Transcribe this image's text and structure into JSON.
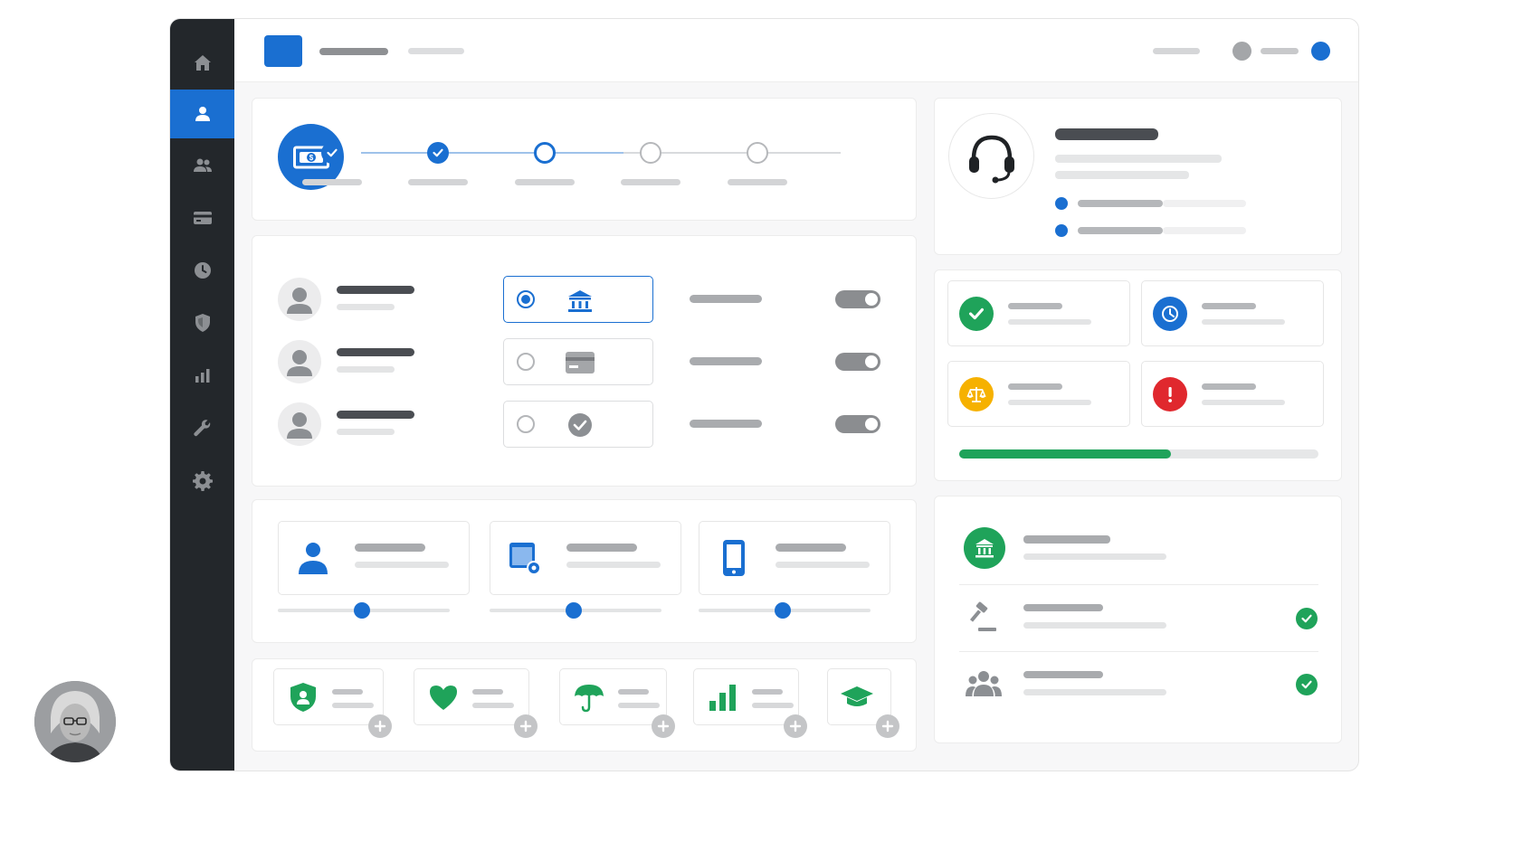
{
  "sidebar": {
    "items": [
      {
        "icon": "home-icon",
        "active": false
      },
      {
        "icon": "user-icon",
        "active": true
      },
      {
        "icon": "users-icon",
        "active": false
      },
      {
        "icon": "card-icon",
        "active": false
      },
      {
        "icon": "clock-icon",
        "active": false
      },
      {
        "icon": "shield-icon",
        "active": false
      },
      {
        "icon": "bar-chart-icon",
        "active": false
      },
      {
        "icon": "wrench-icon",
        "active": false
      },
      {
        "icon": "gear-icon",
        "active": false
      }
    ]
  },
  "stepper": {
    "steps": [
      {
        "state": "done"
      },
      {
        "state": "done"
      },
      {
        "state": "current"
      },
      {
        "state": "pending"
      },
      {
        "state": "pending"
      }
    ]
  },
  "payment_methods": [
    {
      "icon": "bank-icon",
      "selected": true
    },
    {
      "icon": "card-icon",
      "selected": false
    },
    {
      "icon": "check-circle-icon",
      "selected": false
    }
  ],
  "status_tiles": [
    {
      "icon": "check-icon",
      "color": "#1fa35a"
    },
    {
      "icon": "clock-icon",
      "color": "#1a6fd1"
    },
    {
      "icon": "scale-icon",
      "color": "#f6b100"
    },
    {
      "icon": "alert-icon",
      "color": "#e0282e"
    }
  ],
  "overall_progress": 0.59,
  "sliders": [
    {
      "icon": "person-icon",
      "value": 0.49
    },
    {
      "icon": "screen-icon",
      "value": 0.49
    },
    {
      "icon": "tablet-icon",
      "value": 0.49
    }
  ],
  "categories": [
    {
      "icon": "shield-icon"
    },
    {
      "icon": "heart-icon"
    },
    {
      "icon": "umbrella-icon"
    },
    {
      "icon": "bar-chart-icon"
    },
    {
      "icon": "graduation-cap-icon"
    }
  ],
  "colors": {
    "accent": "#1a6fd1",
    "sidebar": "#23272b",
    "success": "#1fa35a",
    "warning": "#f6b100",
    "danger": "#e0282e",
    "progress_fill": "#1fa35a",
    "progress_track": "#e6e7e8"
  }
}
